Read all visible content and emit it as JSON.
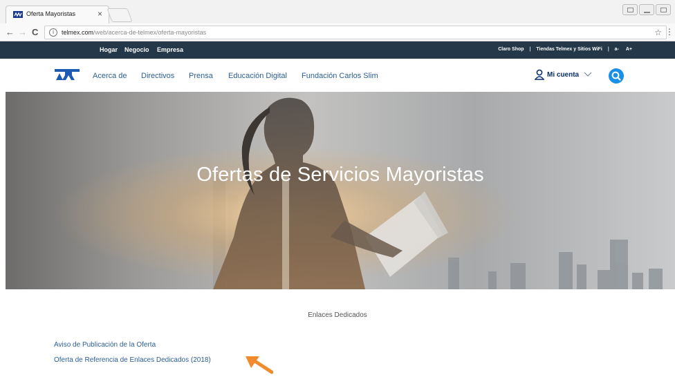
{
  "browser": {
    "tab_title": "Oferta Mayoristas",
    "tab_close": "×",
    "url_host": "telmex.com",
    "url_path": "/web/acerca-de-telmex/oferta-mayoristas",
    "back_icon": "←",
    "forward_icon": "→",
    "reload_icon": "C",
    "info_icon": "i",
    "star_icon": "☆",
    "menu_icon": "⋮"
  },
  "topbar": {
    "segments": [
      "Hogar",
      "Negocio",
      "Empresa"
    ],
    "right_links": [
      "Claro Shop",
      "Tiendas Telmex y Sitios WiFi",
      "a-",
      "A+"
    ],
    "separator": "|",
    "background": "#243849"
  },
  "nav": {
    "items": [
      "Acerca de",
      "Directivos",
      "Prensa",
      "Educación Digital",
      "Fundación Carlos Slim"
    ],
    "account_label": "Mi cuenta",
    "accent": "#1a8fe8",
    "link_color": "#2a5e95"
  },
  "hero": {
    "title": "Ofertas de Servicios Mayoristas"
  },
  "content": {
    "section_title": "Enlaces Dedicados",
    "links": [
      "Aviso de Publicación de la Oferta",
      "Oferta de Referencia de Enlaces Dedicados (2018)"
    ],
    "arrow_color": "#f28a2e"
  }
}
